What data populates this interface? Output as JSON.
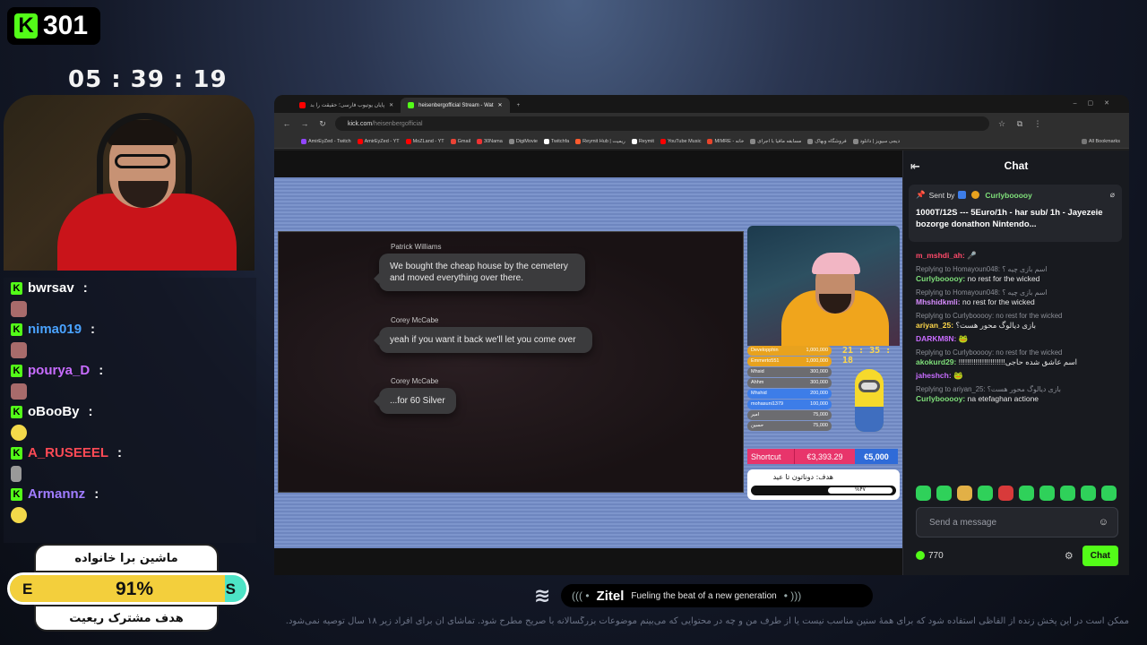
{
  "overlay": {
    "sub_count": "301",
    "timer": "05 : 39 : 19",
    "chat_list": [
      {
        "name": "bwrsav",
        "color": "#ffffff"
      },
      {
        "name": "nima019",
        "color": "#4aa3ff"
      },
      {
        "name": "pourya_D",
        "color": "#c86cff"
      },
      {
        "name": "oBooBy",
        "color": "#ffffff"
      },
      {
        "name": "A_RUSEEEL",
        "color": "#ff4a55"
      },
      {
        "name": "Armannz",
        "color": "#a07cff"
      }
    ],
    "colon": ":",
    "goal_title": "ماشین برا خانواده",
    "goal_left": "E",
    "goal_right": "S",
    "goal_percent_label": "91%",
    "goal_percent": 91,
    "goal_subtitle": "هدف مشترک ریعیت"
  },
  "browser": {
    "tabs": [
      {
        "label": "پایان یوتیوب فارسی؛ حقیقت را بد",
        "icon_color": "#ff0000"
      },
      {
        "label": "heisenbergofficial Stream - Wat",
        "icon_color": "#53fc18"
      }
    ],
    "new_tab": "+",
    "url_domain": "kick.com",
    "url_path": "/heisenbergofficial",
    "bookmarks": [
      "AmirEyZed - Twitch",
      "AmirEyZed - YT",
      "MoZLand - YT",
      "Gmail",
      "30Nama",
      "DigiMovie",
      "Twitchfa",
      "Reymit Hub | ریمیت",
      "Reymit",
      "YouTube Music",
      "MIMRE - خانه",
      "مسابقه مافیا با اجرای",
      "فروشگاه وبهاک",
      "دیجی سیویز | دانلود"
    ],
    "all_bookmarks": "All Bookmarks"
  },
  "game_chat": [
    {
      "name": "Patrick Williams",
      "text": "We bought the cheap house by the cemetery and moved everything over there."
    },
    {
      "name": "Corey McCabe",
      "text": "yeah if you want it back we'll let you come over"
    },
    {
      "name": "Corey McCabe",
      "text": "...for 60 Silver"
    }
  ],
  "cam_overlay": {
    "timer": "21 : 35 : 18",
    "donors": [
      {
        "name": "Developphin",
        "amount": "1,000,000",
        "color": "#e8a21e"
      },
      {
        "name": "Emmerto551",
        "amount": "1,000,000",
        "color": "#e8a21e"
      },
      {
        "name": "Mhsid",
        "amount": "300,000",
        "color": "#6c6c70"
      },
      {
        "name": "Ahhm",
        "amount": "300,000",
        "color": "#6c6c70"
      },
      {
        "name": "Mhshid",
        "amount": "200,000",
        "color": "#3d7de8"
      },
      {
        "name": "mohasuni1379",
        "amount": "100,000",
        "color": "#3d7de8"
      },
      {
        "name": "امیر",
        "amount": "75,000",
        "color": "#6c6c70"
      },
      {
        "name": "حسین",
        "amount": "75,000",
        "color": "#6c6c70"
      }
    ],
    "shortcut_label": "Shortcut",
    "shortcut_amount": "€3,393.29",
    "shortcut_goal": "€5,000",
    "goal_title": "هدف: دوناتون تا عید",
    "goal_percent": "%۴۷"
  },
  "chat": {
    "title": "Chat",
    "pinned_by_label": "Sent by",
    "pinned_by_user": "Curlybooooy",
    "pinned_text": "1000T/12S --- 5Euro/1h - har sub/ 1h - Jayezeie bozorge donathon Nintendo...",
    "messages": [
      {
        "reply": "",
        "user": "m_mshdi_ah:",
        "color": "#ff4a6a",
        "text": "🎤"
      },
      {
        "reply": "Replying to Homayoun048: اسم بازی چیه ؟",
        "user": "Curlybooooy:",
        "color": "#7fe07a",
        "text": "no rest for the wicked"
      },
      {
        "reply": "Replying to Homayoun048: اسم بازی چیه ؟",
        "user": "Mhshidkmli:",
        "color": "#d78cff",
        "text": "no rest for the wicked"
      },
      {
        "reply": "Replying to Curlybooooy: no rest for the wicked",
        "user": "ariyan_25:",
        "color": "#ffd84a",
        "text": "بازی دیالوگ محور هست؟"
      },
      {
        "reply": "",
        "user": "DARKM8N:",
        "color": "#c86cff",
        "text": "🐸"
      },
      {
        "reply": "Replying to Curlybooooy: no rest for the wicked",
        "user": "akokurd29:",
        "color": "#7fe07a",
        "text": "!!!!!!!!!!!!!!!!!!!!!!اسم عاشق شده حاجی"
      },
      {
        "reply": "",
        "user": "jaheshch:",
        "color": "#c86cff",
        "text": "🐸"
      },
      {
        "reply": "Replying to ariyan_25: بازی دیالوگ محور هست؟",
        "user": "Curlybooooy:",
        "color": "#7fe07a",
        "text": "na etefaghan actione"
      }
    ],
    "input_placeholder": "Send a message",
    "points": "770",
    "send_label": "Chat"
  },
  "sponsor": {
    "brand": "Zitel",
    "slogan": "Fueling the beat of a new generation"
  },
  "disclaimer": "ممکن است در این پخش زنده از الفاظی استفاده شود که برای همهٔ سنین مناسب نیست یا از طرف من و چه در محتوایی که می‌بینم موضوعات بزرگسالانه با صریح مطرح شود. تماشای آن برای افراد زیر ۱۸ سال توصیه نمی‌شود."
}
